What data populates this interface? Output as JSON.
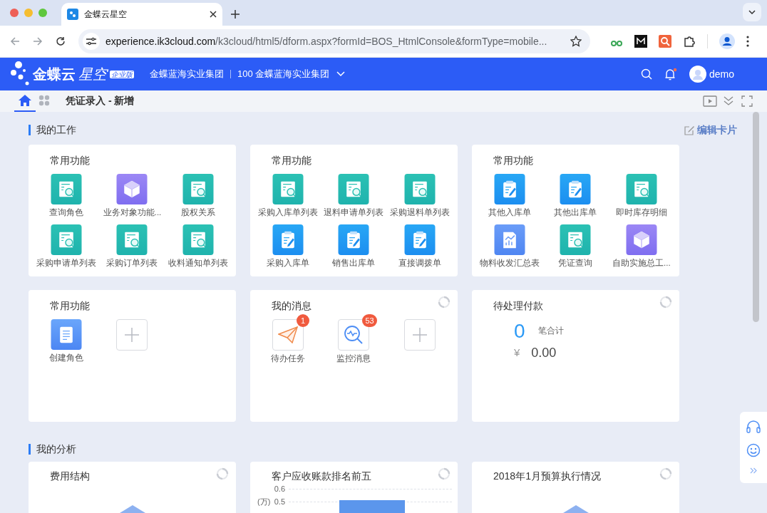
{
  "browser": {
    "tab_title": "金蝶云星空",
    "url_host": "experience.ik3cloud.com",
    "url_path": "/k3cloud/html5/dform.aspx?formId=BOS_HtmlConsole&formType=mobile..."
  },
  "header": {
    "brand": "金蝶云",
    "brand_suffix": "星空",
    "edition": "企业版",
    "org": "金蝶蓝海实业集团",
    "org_code": "100 金蝶蓝海实业集团",
    "user": "demo",
    "has_notification": true
  },
  "page_tabs": [
    {
      "kind": "home",
      "selected": true
    },
    {
      "kind": "apps",
      "selected": false
    },
    {
      "kind": "page",
      "title": "凭证录入 - 新增",
      "selected": false
    }
  ],
  "work": {
    "title": "我的工作",
    "edit_link": "编辑卡片",
    "function_cards": [
      {
        "title": "常用功能",
        "items": [
          {
            "label": "查询角色",
            "kind": "search-doc"
          },
          {
            "label": "业务对象功能...",
            "kind": "cube"
          },
          {
            "label": "股权关系",
            "kind": "search-doc"
          },
          {
            "label": "采购申请单列表",
            "kind": "search-doc"
          },
          {
            "label": "采购订单列表",
            "kind": "search-doc"
          },
          {
            "label": "收料通知单列表",
            "kind": "search-doc"
          }
        ]
      },
      {
        "title": "常用功能",
        "items": [
          {
            "label": "采购入库单列表",
            "kind": "search-doc"
          },
          {
            "label": "退料申请单列表",
            "kind": "search-doc"
          },
          {
            "label": "采购退料单列表",
            "kind": "search-doc"
          },
          {
            "label": "采购入库单",
            "kind": "clipboard"
          },
          {
            "label": "销售出库单",
            "kind": "clipboard"
          },
          {
            "label": "直接调拨单",
            "kind": "clipboard"
          }
        ]
      },
      {
        "title": "常用功能",
        "items": [
          {
            "label": "其他入库单",
            "kind": "clipboard"
          },
          {
            "label": "其他出库单",
            "kind": "clipboard"
          },
          {
            "label": "即时库存明细",
            "kind": "search-doc"
          },
          {
            "label": "物料收发汇总表",
            "kind": "report"
          },
          {
            "label": "凭证查询",
            "kind": "search-doc"
          },
          {
            "label": "自助实施总工...",
            "kind": "cube"
          }
        ]
      }
    ],
    "widgets": [
      {
        "kind": "functions",
        "title": "常用功能",
        "items": [
          {
            "label": "创建角色",
            "kind": "scroll"
          }
        ]
      },
      {
        "kind": "messages",
        "title": "我的消息",
        "items": [
          {
            "label": "待办任务",
            "kind": "plane",
            "count": "1"
          },
          {
            "label": "监控消息",
            "kind": "monitor",
            "count": "53"
          }
        ]
      },
      {
        "kind": "payments",
        "title": "待处理付款",
        "count": "0",
        "count_label": "笔合计",
        "currency": "¥",
        "amount": "0.00"
      }
    ]
  },
  "analysis": {
    "title": "我的分析",
    "cards": [
      {
        "title": "费用结构",
        "kind": "pie"
      },
      {
        "title": "客户应收账款排名前五",
        "kind": "bar",
        "axis_unit": "(万)",
        "tick_labels": [
          "0.6",
          "0.5"
        ]
      },
      {
        "title": "2018年1月预算执行情况",
        "kind": "pie"
      }
    ]
  }
}
